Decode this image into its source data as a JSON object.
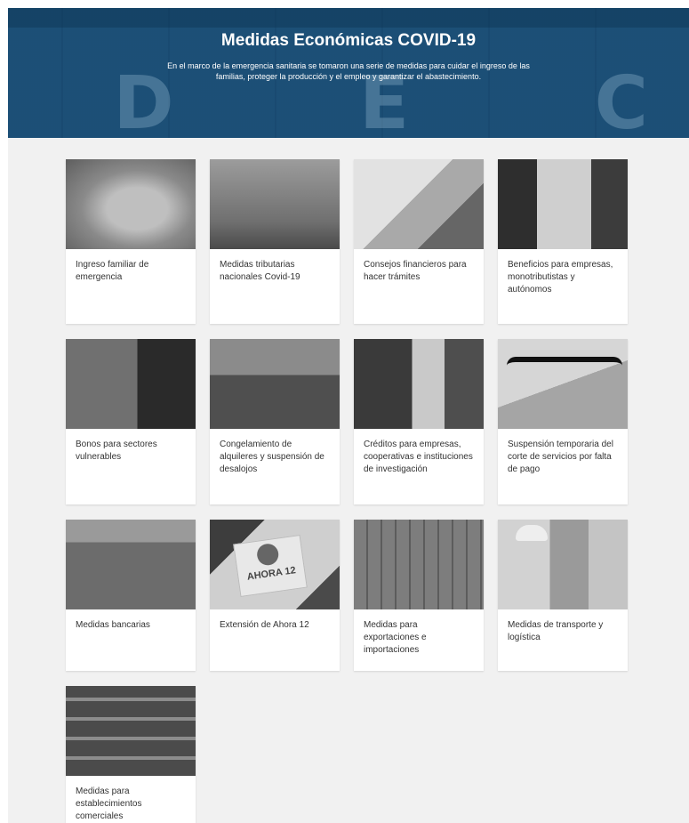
{
  "hero": {
    "title": "Medidas Económicas COVID-19",
    "subtitle": "En el marco de la emergencia sanitaria se tomaron una serie de medidas para cuidar el ingreso de las familias, proteger la producción y el empleo y garantizar el abastecimiento.",
    "background_color": "#1f5a85"
  },
  "cards": [
    {
      "label": "Ingreso familiar de emergencia"
    },
    {
      "label": "Medidas tributarias nacionales Covid-19"
    },
    {
      "label": "Consejos financieros para hacer trámites"
    },
    {
      "label": "Beneficios para empresas, monotributistas y autónomos"
    },
    {
      "label": "Bonos para sectores vulnerables"
    },
    {
      "label": "Congelamiento de alquileres y suspensión de desalojos"
    },
    {
      "label": "Créditos para empresas, cooperativas e instituciones de investigación"
    },
    {
      "label": "Suspensión temporaria del corte de servicios por falta de pago"
    },
    {
      "label": "Medidas bancarias"
    },
    {
      "label": "Extensión de Ahora 12",
      "image_text": "AHORA 12"
    },
    {
      "label": "Medidas para exportaciones e importaciones"
    },
    {
      "label": "Medidas de transporte y logística"
    },
    {
      "label": "Medidas para establecimientos comerciales"
    }
  ]
}
